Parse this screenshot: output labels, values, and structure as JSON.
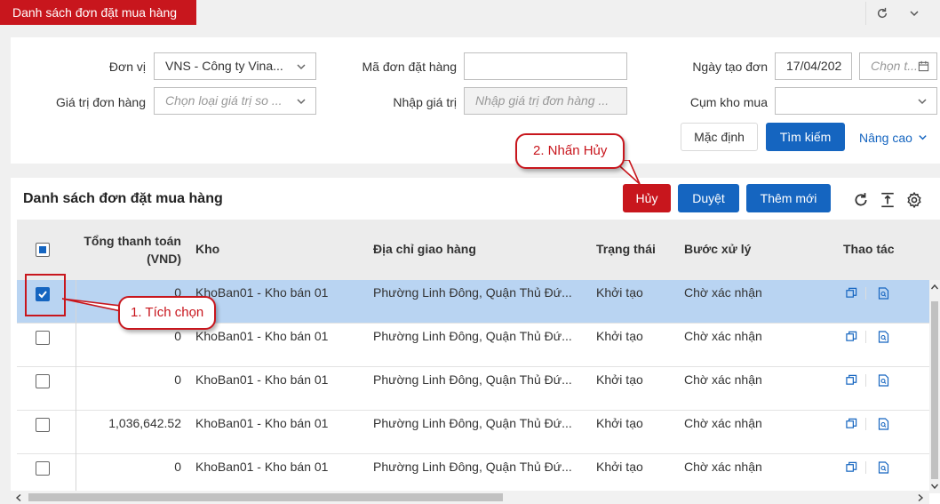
{
  "tab": {
    "title": "Danh sách đơn đặt mua hàng"
  },
  "filters": {
    "don_vi_label": "Đơn vị",
    "don_vi_value": "VNS - Công ty Vina...",
    "gia_tri_label": "Giá trị đơn hàng",
    "gia_tri_placeholder": "Chọn loại giá trị so ...",
    "ma_don_label": "Mã đơn đặt hàng",
    "ma_don_value": "",
    "nhap_gia_tri_label": "Nhập giá trị",
    "nhap_gia_tri_placeholder": "Nhập giá trị đơn hàng ...",
    "ngay_tao_label": "Ngày tạo đơn",
    "ngay_tao_from": "17/04/202",
    "ngay_tao_to_placeholder": "Chọn t...",
    "cum_kho_label": "Cụm kho mua",
    "cum_kho_value": "",
    "default_button": "Mặc định",
    "search_button": "Tìm kiếm",
    "advanced_link": "Nâng cao"
  },
  "list": {
    "title": "Danh sách đơn đặt mua hàng",
    "cancel_button": "Hủy",
    "approve_button": "Duyệt",
    "add_button": "Thêm mới",
    "columns": {
      "total_line1": "Tổng thanh toán",
      "total_line2": "(VND)",
      "kho": "Kho",
      "address": "Địa chỉ giao hàng",
      "status": "Trạng thái",
      "step": "Bước xử lý",
      "actions": "Thao tác"
    },
    "rows": [
      {
        "selected": true,
        "total": "0",
        "kho": "KhoBan01 - Kho bán 01",
        "address": "Phường Linh Đông, Quận Thủ Đứ...",
        "status": "Khởi tạo",
        "step": "Chờ xác nhận"
      },
      {
        "selected": false,
        "total": "0",
        "kho": "KhoBan01 - Kho bán 01",
        "address": "Phường Linh Đông, Quận Thủ Đứ...",
        "status": "Khởi tạo",
        "step": "Chờ xác nhận"
      },
      {
        "selected": false,
        "total": "0",
        "kho": "KhoBan01 - Kho bán 01",
        "address": "Phường Linh Đông, Quận Thủ Đứ...",
        "status": "Khởi tạo",
        "step": "Chờ xác nhận"
      },
      {
        "selected": false,
        "total": "1,036,642.52",
        "kho": "KhoBan01 - Kho bán 01",
        "address": "Phường Linh Đông, Quận Thủ Đứ...",
        "status": "Khởi tạo",
        "step": "Chờ xác nhận"
      },
      {
        "selected": false,
        "total": "0",
        "kho": "KhoBan01 - Kho bán 01",
        "address": "Phường Linh Đông, Quận Thủ Đứ...",
        "status": "Khởi tạo",
        "step": "Chờ xác nhận"
      }
    ]
  },
  "annotations": {
    "step1": "1. Tích chọn",
    "step2": "2. Nhấn Hủy"
  },
  "colors": {
    "brand_red": "#c8161d",
    "primary_blue": "#1565c0",
    "selected_row": "#b9d4f2"
  },
  "icons": [
    "refresh-icon",
    "chevron-down-icon",
    "calendar-icon",
    "column-height-icon",
    "settings-icon",
    "copy-icon",
    "file-search-icon"
  ]
}
